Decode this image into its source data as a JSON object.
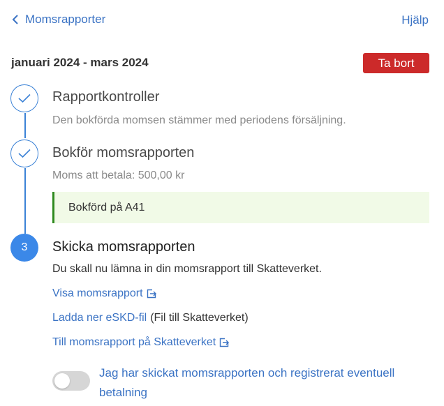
{
  "header": {
    "back_label": "Momsrapporter",
    "help_label": "Hjälp"
  },
  "period": {
    "title": "januari 2024 - mars 2024",
    "delete_label": "Ta bort"
  },
  "steps": [
    {
      "status": "done",
      "title": "Rapportkontroller",
      "description": "Den bokförda momsen stämmer med periodens försäljning."
    },
    {
      "status": "done",
      "title": "Bokför momsrapporten",
      "description": "Moms att betala: 500,00 kr",
      "note": "Bokförd på A41"
    },
    {
      "status": "active",
      "number": "3",
      "title": "Skicka momsrapporten",
      "description": "Du skall nu lämna in din momsrapport till Skatteverket.",
      "links": {
        "view_report": "Visa momsrapport",
        "download_eskd": "Ladda ner eSKD-fil",
        "download_eskd_suffix": "(Fil till Skatteverket)",
        "to_skatteverket": "Till momsrapport på Skatteverket"
      },
      "confirm_toggle": {
        "checked": false,
        "label": "Jag har skickat momsrapporten och registrerat eventuell betalning"
      }
    }
  ],
  "colors": {
    "accent": "#3b73c4",
    "step_blue": "#3b88e8",
    "danger": "#cc2a2a",
    "note_bg": "#f1fae7",
    "note_border": "#2f8a1f"
  }
}
